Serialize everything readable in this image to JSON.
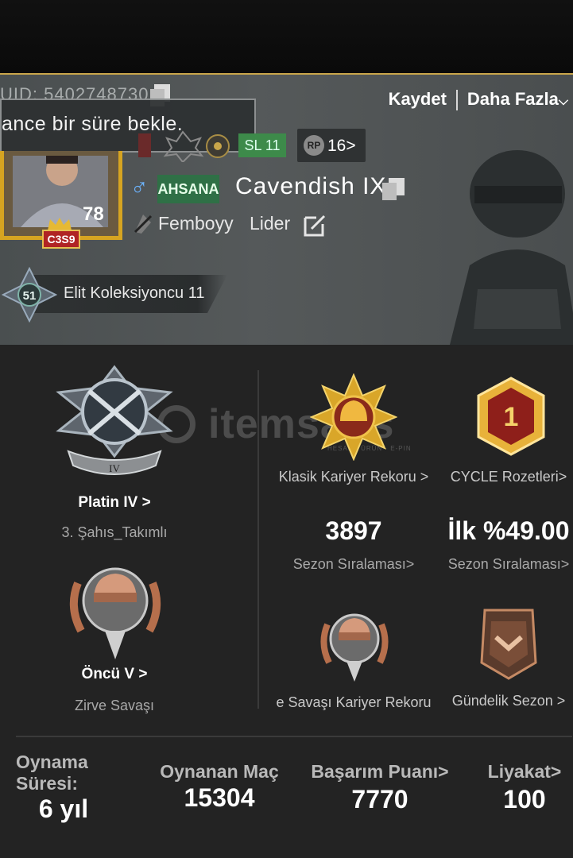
{
  "header": {
    "uid": "UID: 5402748730",
    "toast": "ance bir süre bekle.",
    "save_label": "Kaydet",
    "more_label": "Daha Fazla",
    "sl_badge": "SL 11",
    "rp_badge": "16>",
    "rp_icon": "RP"
  },
  "profile": {
    "avatar_level": "78",
    "avatar_tag": "C3S9",
    "gender_icon": "♂",
    "title_tag": "AHSANA",
    "name": "Cavendish IX",
    "clan": "Femboyy",
    "role": "Lider",
    "elite_level": "51",
    "elite_label": "Elit Koleksiyoncu 11"
  },
  "ranks": {
    "left_top_tier": "Platin IV",
    "left_top_arrow": ">",
    "left_top_mode": "3. Şahıs_Takımlı",
    "left_top_numeral": "IV",
    "left_bottom_tier": "Öncü V",
    "left_bottom_arrow": ">",
    "left_bottom_mode": "Zirve Savaşı"
  },
  "records": {
    "classic_label": "Klasik Kariyer Rekoru >",
    "cycle_label": "CYCLE Rozetleri>",
    "cycle_num": "1",
    "season_rank_value": "3897",
    "season_rank_label": "Sezon Sıralaması>",
    "top_percent_value": "İlk %49.00",
    "top_percent_label": "Sezon Sıralaması>",
    "peak_label": "e Savaşı Kariyer Rekoru",
    "daily_label": "Gündelik Sezon >"
  },
  "stats": {
    "play_time_label_1": "Oynama",
    "play_time_label_2": "Süresi:",
    "play_time_value": "6 yıl",
    "matches_label": "Oynanan Maç",
    "matches_value": "15304",
    "achievement_label": "Başarım Puanı>",
    "achievement_value": "7770",
    "merit_label": "Liyakat>",
    "merit_value": "100"
  },
  "watermark": {
    "text": "itemsatis",
    "sub": "HESAP · ÜRÜN · E-PIN"
  },
  "colors": {
    "gold": "#d6a421",
    "panel": "#232323",
    "profile_bg": "#4f5354",
    "green_tag": "#2f7046"
  }
}
